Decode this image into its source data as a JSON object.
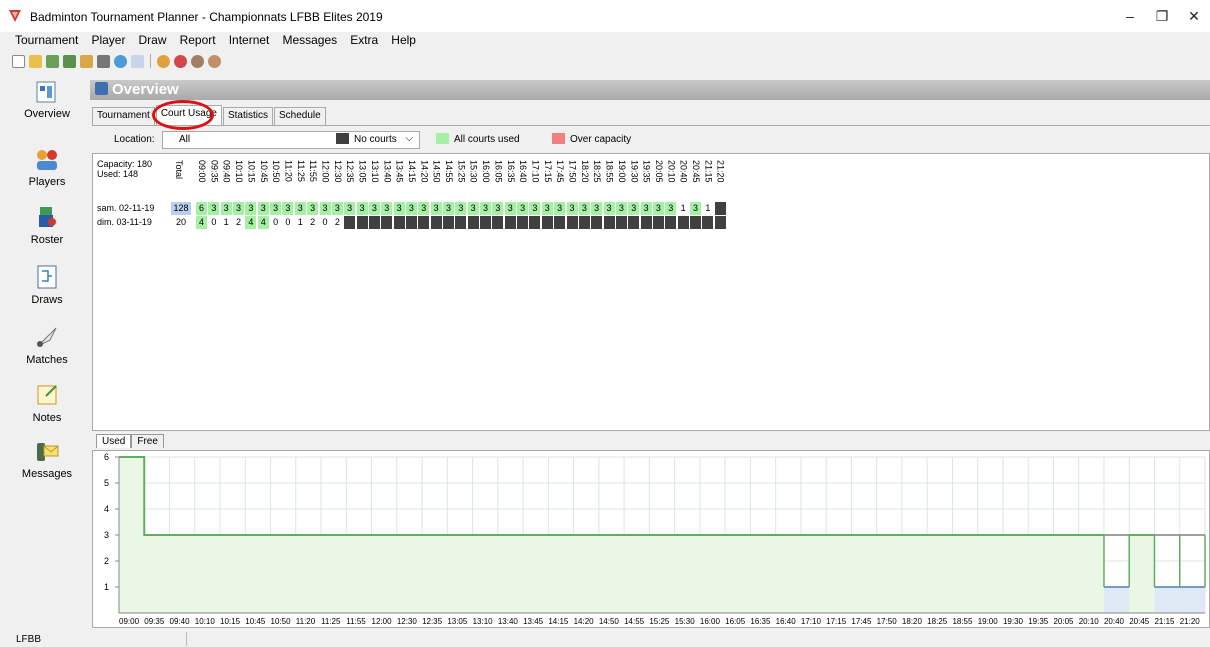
{
  "window": {
    "title": "Badminton Tournament Planner - Championnats LFBB Elites 2019",
    "minimize": "–",
    "maximize": "❐",
    "close": "✕"
  },
  "menu": [
    "Tournament",
    "Player",
    "Draw",
    "Report",
    "Internet",
    "Messages",
    "Extra",
    "Help"
  ],
  "nav": [
    {
      "label": "Overview",
      "icon": "overview-icon"
    },
    {
      "label": "Players",
      "icon": "players-icon"
    },
    {
      "label": "Roster",
      "icon": "roster-icon"
    },
    {
      "label": "Draws",
      "icon": "draws-icon"
    },
    {
      "label": "Matches",
      "icon": "shuttlecock-icon"
    },
    {
      "label": "Notes",
      "icon": "notes-icon"
    },
    {
      "label": "Messages",
      "icon": "messages-icon"
    }
  ],
  "banner": "Overview",
  "tabs": [
    "Tournament",
    "Court Usage",
    "Statistics",
    "Schedule"
  ],
  "active_tab": "Court Usage",
  "filter": {
    "location_label": "Location:",
    "location_value": "All",
    "legend": [
      {
        "label": "No courts",
        "color": "#404040"
      },
      {
        "label": "All courts used",
        "color": "#a6f0a6"
      },
      {
        "label": "Over capacity",
        "color": "#f08080"
      }
    ]
  },
  "grid": {
    "capacity": "Capacity: 180",
    "used": "Used: 148",
    "total_header": "Total",
    "times": [
      "09:00",
      "09:35",
      "09:40",
      "10:10",
      "10:15",
      "10:45",
      "10:50",
      "11:20",
      "11:25",
      "11:55",
      "12:00",
      "12:30",
      "12:35",
      "13:05",
      "13:10",
      "13:40",
      "13:45",
      "14:15",
      "14:20",
      "14:50",
      "14:55",
      "15:25",
      "15:30",
      "16:00",
      "16:05",
      "16:35",
      "16:40",
      "17:10",
      "17:15",
      "17:45",
      "17:50",
      "18:20",
      "18:25",
      "18:55",
      "19:00",
      "19:30",
      "19:35",
      "20:05",
      "20:10",
      "20:40",
      "20:45",
      "21:15",
      "21:20"
    ],
    "rows": [
      {
        "label": "sam. 02-11-19",
        "total": "128",
        "values": [
          "6",
          "3",
          "3",
          "3",
          "3",
          "3",
          "3",
          "3",
          "3",
          "3",
          "3",
          "3",
          "3",
          "3",
          "3",
          "3",
          "3",
          "3",
          "3",
          "3",
          "3",
          "3",
          "3",
          "3",
          "3",
          "3",
          "3",
          "3",
          "3",
          "3",
          "3",
          "3",
          "3",
          "3",
          "3",
          "3",
          "3",
          "3",
          "3",
          "1",
          "3",
          "1"
        ]
      },
      {
        "label": "dim. 03-11-19",
        "total": "20",
        "values": [
          "4",
          "0",
          "1",
          "2",
          "4",
          "4",
          "0",
          "0",
          "1",
          "2",
          "0",
          "2"
        ]
      }
    ]
  },
  "bottom_tabs": [
    "Used",
    "Free"
  ],
  "chart_data": {
    "type": "line",
    "x": [
      "09:00",
      "09:35",
      "09:40",
      "10:10",
      "10:15",
      "10:45",
      "10:50",
      "11:20",
      "11:25",
      "11:55",
      "12:00",
      "12:30",
      "12:35",
      "13:05",
      "13:10",
      "13:40",
      "13:45",
      "14:15",
      "14:20",
      "14:50",
      "14:55",
      "15:25",
      "15:30",
      "16:00",
      "16:05",
      "16:35",
      "16:40",
      "17:10",
      "17:15",
      "17:45",
      "17:50",
      "18:20",
      "18:25",
      "18:55",
      "19:00",
      "19:30",
      "19:35",
      "20:05",
      "20:10",
      "20:40",
      "20:45",
      "21:15",
      "21:20"
    ],
    "series": [
      {
        "values": [
          6,
          3,
          3,
          3,
          3,
          3,
          3,
          3,
          3,
          3,
          3,
          3,
          3,
          3,
          3,
          3,
          3,
          3,
          3,
          3,
          3,
          3,
          3,
          3,
          3,
          3,
          3,
          3,
          3,
          3,
          3,
          3,
          3,
          3,
          3,
          3,
          3,
          3,
          3,
          1,
          3,
          1,
          1
        ]
      }
    ],
    "y_ticks": [
      "1",
      "2",
      "3",
      "4",
      "5",
      "6"
    ],
    "ylim": [
      0,
      6
    ],
    "colors": {
      "line": "#5fae5f",
      "fill": "#eaf6e6",
      "grid": "#d9e8e0",
      "capacity": "#808080",
      "low": "#4a7fb5"
    }
  },
  "status": {
    "left": "LFBB"
  }
}
